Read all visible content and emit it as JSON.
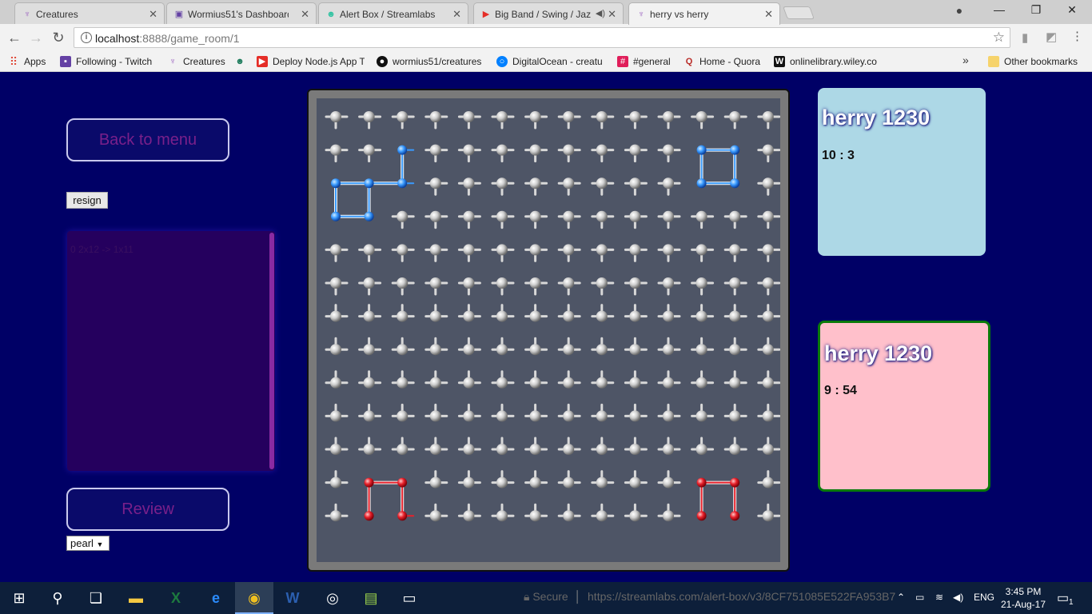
{
  "browser": {
    "tabs": [
      {
        "label": "Creatures",
        "icon": "creature-icon",
        "active": false
      },
      {
        "label": "Wormius51's Dashboard",
        "icon": "twitch-icon",
        "active": false
      },
      {
        "label": "Alert Box / Streamlabs",
        "icon": "streamlabs-icon",
        "active": false
      },
      {
        "label": "Big Band / Swing / Jaz",
        "icon": "youtube-icon",
        "active": false
      },
      {
        "label": "herry vs herry",
        "icon": "creature-icon",
        "active": true
      }
    ],
    "url_host": "localhost",
    "url_rest": ":8888/game_room/1",
    "bookmarks": [
      {
        "label": "Apps",
        "icon": "apps-grid-icon"
      },
      {
        "label": "Following - Twitch",
        "icon": "twitch-icon"
      },
      {
        "label": "Creatures",
        "icon": "creature-icon"
      },
      {
        "label": "",
        "icon": "alien-icon"
      },
      {
        "label": "Deploy Node.js App T",
        "icon": "youtube-icon"
      },
      {
        "label": "wormius51/creatures",
        "icon": "github-icon"
      },
      {
        "label": "DigitalOcean - creatu",
        "icon": "digitalocean-icon"
      },
      {
        "label": "#general",
        "icon": "slack-icon"
      },
      {
        "label": "Home - Quora",
        "icon": "quora-icon"
      },
      {
        "label": "onlinelibrary.wiley.co",
        "icon": "wiley-icon"
      }
    ],
    "overflow": "»",
    "other_bookmarks": "Other bookmarks"
  },
  "game": {
    "back_label": "Back to menu",
    "resign_label": "resign",
    "log_text": "0 2x12 -> 1x11",
    "review_label": "Review",
    "variant_value": "pearl",
    "board": {
      "rows": 13,
      "cols": 14,
      "color_bg": "#4e5566",
      "color_blue": "#3a9bff",
      "color_red": "#e8202a",
      "color_piece": "#c8c8c8"
    },
    "player_top": {
      "name": "herry 1230",
      "time": "10 : 3",
      "color": "#add8e6"
    },
    "player_bottom": {
      "name": "herry 1230",
      "time": "9 : 54",
      "color": "#ffc0cb",
      "highlight": "#0a7a0a"
    }
  },
  "taskbar": {
    "overlay_text_a": "Secure",
    "overlay_text_b": "https://streamlabs.com/alert-box/v3/8CF751085E522FA953B7",
    "lang": "ENG",
    "time": "3:45 PM",
    "date": "21-Aug-17",
    "notification_count": "1",
    "apps": [
      "windows-start-icon",
      "search-icon",
      "task-view-icon",
      "file-explorer-icon",
      "excel-icon",
      "edge-icon",
      "chrome-icon",
      "word-icon",
      "obs-icon",
      "notepad-icon",
      "terminal-icon"
    ]
  }
}
